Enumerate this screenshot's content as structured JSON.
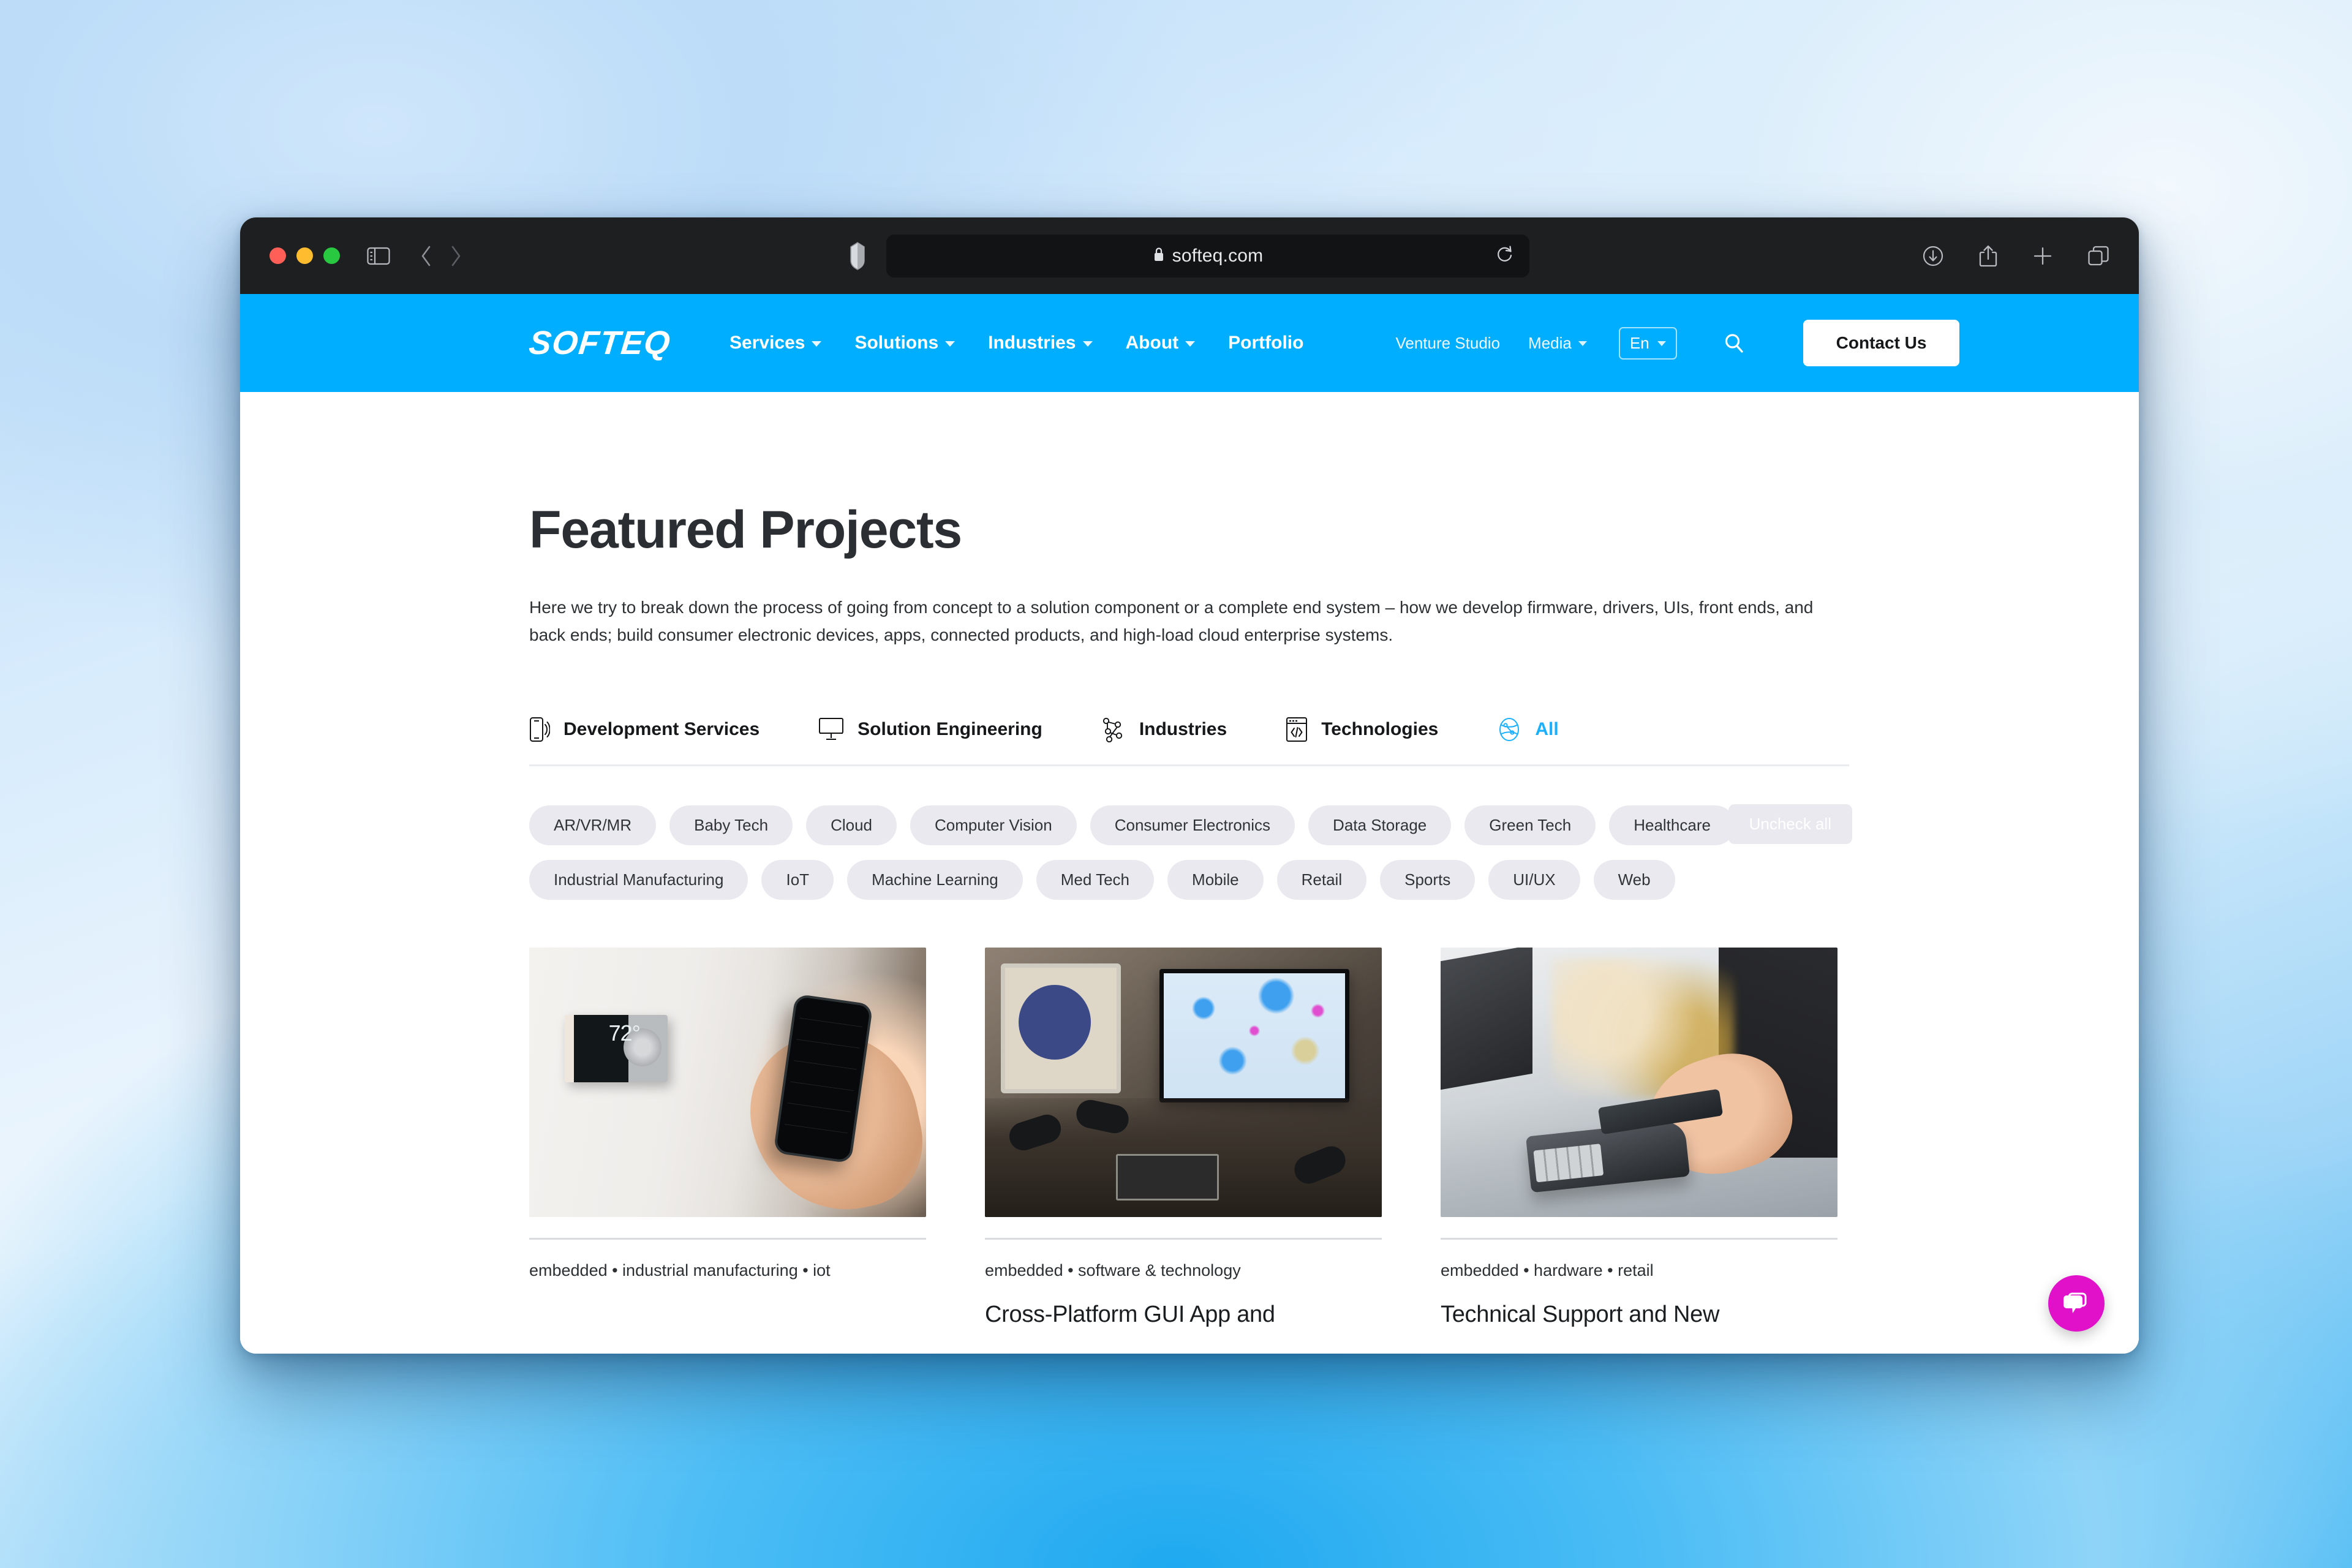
{
  "browser": {
    "url": "softeq.com",
    "lock_icon": "lock-icon",
    "traffic_lights": [
      "close-button",
      "minimize-button",
      "maximize-button"
    ],
    "toolbar_icons": [
      "sidebar-toggle-icon",
      "back-arrow-icon",
      "forward-arrow-icon",
      "shield-icon",
      "reload-icon",
      "downloads-icon",
      "share-icon",
      "new-tab-icon",
      "tab-overview-icon"
    ]
  },
  "site_header": {
    "logo": "SOFTEQ",
    "nav": [
      {
        "label": "Services",
        "has_dropdown": true
      },
      {
        "label": "Solutions",
        "has_dropdown": true
      },
      {
        "label": "Industries",
        "has_dropdown": true
      },
      {
        "label": "About",
        "has_dropdown": true
      },
      {
        "label": "Portfolio",
        "has_dropdown": false
      }
    ],
    "secondary_nav": [
      {
        "label": "Venture Studio",
        "has_dropdown": false
      },
      {
        "label": "Media",
        "has_dropdown": true
      }
    ],
    "language": "En",
    "search_icon": "search-icon",
    "contact_button": "Contact Us",
    "accent_color": "#00aeff"
  },
  "page": {
    "title": "Featured Projects",
    "intro": "Here we try to break down the process of going from concept to a solution component or a complete end system – how we develop firmware, drivers, UIs, front ends, and back ends; build consumer electronic devices, apps, connected products, and high-load cloud enterprise systems."
  },
  "category_tabs": [
    {
      "label": "Development Services",
      "icon": "mobile-signal-icon",
      "active": false
    },
    {
      "label": "Solution Engineering",
      "icon": "desktop-monitor-icon",
      "active": false
    },
    {
      "label": "Industries",
      "icon": "network-nodes-icon",
      "active": false
    },
    {
      "label": "Technologies",
      "icon": "code-window-icon",
      "active": false
    },
    {
      "label": "All",
      "icon": "globe-circuit-icon",
      "active": true
    }
  ],
  "filters": {
    "row1": [
      "AR/VR/MR",
      "Baby Tech",
      "Cloud",
      "Computer Vision",
      "Consumer Electronics",
      "Data Storage",
      "Green Tech",
      "Healthcare"
    ],
    "row2": [
      "Industrial Manufacturing",
      "IoT",
      "Machine Learning",
      "Med Tech",
      "Mobile",
      "Retail",
      "Sports",
      "UI/UX",
      "Web"
    ],
    "uncheck_all": "Uncheck all"
  },
  "projects": [
    {
      "tags": "embedded • industrial manufacturing • iot",
      "title": "",
      "image_alt": "smart-thermostat-photo"
    },
    {
      "tags": "embedded • software & technology",
      "title": "Cross-Platform GUI App and",
      "image_alt": "ship-bridge-navigation-console-photo"
    },
    {
      "tags": "embedded • hardware • retail",
      "title": "Technical Support and New",
      "image_alt": "contactless-payment-terminal-photo"
    }
  ],
  "chat": {
    "icon": "chat-bubble-icon",
    "color": "#e011c9"
  }
}
